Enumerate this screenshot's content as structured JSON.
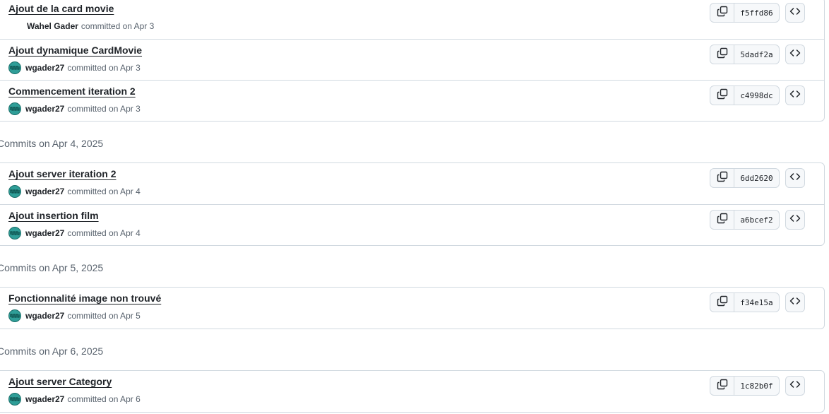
{
  "groups": [
    {
      "heading": "",
      "commits": [
        {
          "title": "Ajout de la card movie",
          "author": "Wahel Gader",
          "has_avatar": false,
          "date_text": "committed on Apr 3",
          "sha": "f5ffd86"
        },
        {
          "title": "Ajout dynamique CardMovie",
          "author": "wgader27",
          "has_avatar": true,
          "date_text": "committed on Apr 3",
          "sha": "5dadf2a"
        },
        {
          "title": "Commencement iteration 2",
          "author": "wgader27",
          "has_avatar": true,
          "date_text": "committed on Apr 3",
          "sha": "c4998dc"
        }
      ]
    },
    {
      "heading": "Commits on Apr 4, 2025",
      "commits": [
        {
          "title": "Ajout server iteration 2",
          "author": "wgader27",
          "has_avatar": true,
          "date_text": "committed on Apr 4",
          "sha": "6dd2620"
        },
        {
          "title": "Ajout insertion film",
          "author": "wgader27",
          "has_avatar": true,
          "date_text": "committed on Apr 4",
          "sha": "a6bcef2"
        }
      ]
    },
    {
      "heading": "Commits on Apr 5, 2025",
      "commits": [
        {
          "title": "Fonctionnalité image non trouvé",
          "author": "wgader27",
          "has_avatar": true,
          "date_text": "committed on Apr 5",
          "sha": "f34e15a"
        }
      ]
    },
    {
      "heading": "Commits on Apr 6, 2025",
      "commits": [
        {
          "title": "Ajout server Category",
          "author": "wgader27",
          "has_avatar": true,
          "date_text": "committed on Apr 6",
          "sha": "1c82b0f"
        }
      ]
    }
  ],
  "icons": {
    "copy": "copy-icon",
    "browse": "code-icon",
    "avatar": "identicon-avatar"
  },
  "colors": {
    "avatar": "#2f9e98",
    "border": "#d1d9e0",
    "muted_text": "#59636e",
    "button_bg": "#f6f8fa"
  }
}
